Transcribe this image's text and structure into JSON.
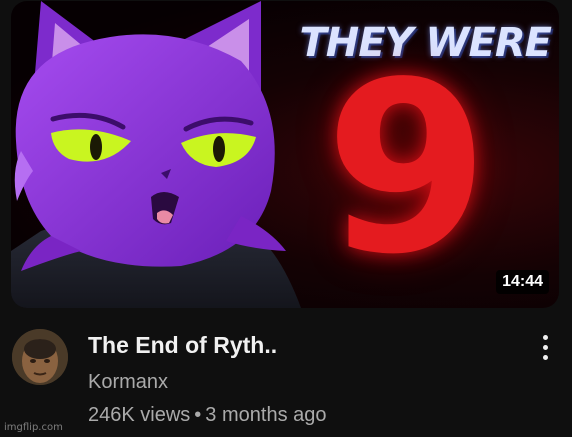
{
  "thumbnail": {
    "headline": "THEY WERE",
    "number": "9",
    "duration": "14:44",
    "character_icon": "purple-cat-character"
  },
  "video": {
    "title": "The End of Ryth..",
    "channel": "Kormanx",
    "views": "246K views",
    "separator": "•",
    "age": "3 months ago"
  },
  "icons": {
    "avatar": "channel-avatar",
    "menu": "more-vert-icon"
  },
  "colors": {
    "background": "#0f0f0f",
    "title": "#f1f1f1",
    "secondary": "#aaaaaa",
    "accent_red": "#e41b1f",
    "character_purple": "#8a2fd6"
  },
  "watermark": "imgflip.com"
}
